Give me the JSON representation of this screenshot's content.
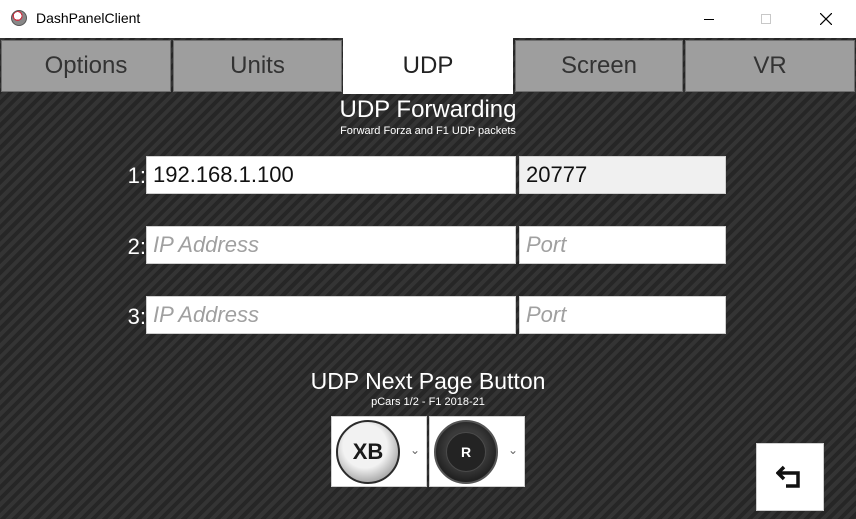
{
  "window": {
    "title": "DashPanelClient"
  },
  "tabs": [
    {
      "label": "Options",
      "active": false
    },
    {
      "label": "Units",
      "active": false
    },
    {
      "label": "UDP",
      "active": true
    },
    {
      "label": "Screen",
      "active": false
    },
    {
      "label": "VR",
      "active": false
    }
  ],
  "udp_forwarding": {
    "title": "UDP Forwarding",
    "subtitle": "Forward Forza and F1 UDP packets",
    "rows": [
      {
        "label": "1:",
        "ip_value": "192.168.1.100",
        "ip_placeholder": "IP Address",
        "port_value": "20777",
        "port_placeholder": "Port"
      },
      {
        "label": "2:",
        "ip_value": "",
        "ip_placeholder": "IP Address",
        "port_value": "",
        "port_placeholder": "Port"
      },
      {
        "label": "3:",
        "ip_value": "",
        "ip_placeholder": "IP Address",
        "port_value": "",
        "port_placeholder": "Port"
      }
    ]
  },
  "next_page": {
    "title": "UDP Next Page Button",
    "subtitle": "pCars 1/2 - F1 2018-21",
    "xbox_button_label": "XB",
    "selected_button_label": "R"
  },
  "icons": {
    "app": "app-icon",
    "back": "back-arrow-icon",
    "dropdown": "chevron-down-icon"
  },
  "colors": {
    "tab_inactive": "#9e9e9e",
    "tab_active": "#ffffff",
    "background": "#2c2c2c",
    "text_light": "#ffffff"
  }
}
